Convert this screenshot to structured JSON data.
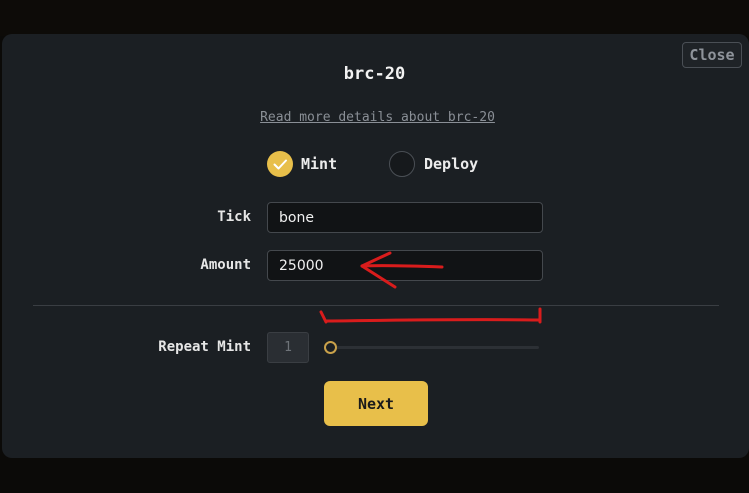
{
  "modal": {
    "title": "brc-20",
    "close_label": "Close",
    "details_link": "Read more details about brc-20"
  },
  "mode": {
    "options": [
      {
        "label": "Mint",
        "selected": true
      },
      {
        "label": "Deploy",
        "selected": false
      }
    ]
  },
  "form": {
    "tick": {
      "label": "Tick",
      "value": "bone"
    },
    "amount": {
      "label": "Amount",
      "value": "25000"
    },
    "repeat": {
      "label": "Repeat Mint",
      "value": "1",
      "slider_fraction": 0
    }
  },
  "next_label": "Next",
  "colors": {
    "accent": "#e8bf4a",
    "modal_bg": "#1b1f23",
    "annotation_red": "#d91c1c"
  }
}
